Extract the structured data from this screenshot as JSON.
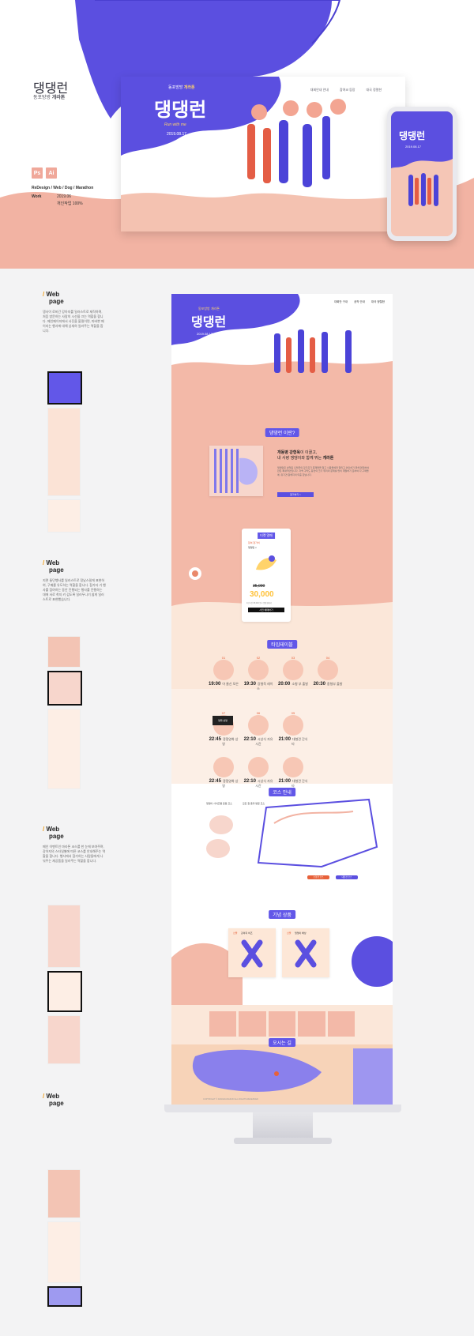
{
  "brand": {
    "title": "댕댕런",
    "subtitle_plain": "동포방방",
    "subtitle_bold": "개라톤",
    "tools": [
      "Ps",
      "Ai"
    ],
    "category": "ReDesign / Web / Dog / Marathon",
    "work_label": "Work",
    "work_date": "2019.06",
    "work_contribution": "개인작업 100%"
  },
  "hero_monitor": {
    "badge_plain": "동포방방",
    "badge_bold": "개라톤",
    "title": "댕댕런",
    "tagline": "Run with me",
    "date": "2019.08.17",
    "nav": [
      "대회안내 안내",
      "참여코 등장",
      "대국 정렬한"
    ]
  },
  "phone": {
    "title": "댕댕런",
    "date": "2019.08.17"
  },
  "sections": [
    {
      "label": "Web",
      "label2": "page",
      "desc": "댕사이 로비간 강아지를 일러스트로 제작하며, 처음 방문하는 사람의 시선을 끄는 역할을 합니다. 메인페이지에서 사진을 불필이면, 마바쁜 페이지는 행사에 대해 상세하 일러주는 역할을 합니다."
    },
    {
      "label": "Web",
      "label2": "page",
      "desc": "지면 둘던행사를 일러스트로 정났스릴게 표현하여, 구매를 유도하는 역할을 합니다. 참가자 기 행사를 참여하는 동안 진행되는 행사를 진행하는 대에 서로 착지 키 감도록 일러두나기 쉽게 일러스트로 표현했습니다."
    },
    {
      "label": "Web",
      "label2": "page",
      "desc": "메인 이벤트인 마라톤 코스를 한 눈에 보여주며, 강아지의 스타일별에 따른 코스를 안내해주는 역할을 합니다. 행사에서 참가하는 사람들에게 나눠주는 재공품을 일러주는 역할을 합니다."
    },
    {
      "label": "Web",
      "label2": "page",
      "desc": ""
    }
  ],
  "page": {
    "nav": [
      "대회안 구내",
      "공작 안내",
      "대국 정렬한"
    ],
    "hero_badge": "동포방방 개라톤",
    "hero_title": "댕댕런",
    "hero_date": "2019.08.17",
    "about_tag": "댕댕런 이란?",
    "about_title_1": "개동병 강형욱",
    "about_title_2": "이 이끌고,",
    "about_title_3": "내 사랑 댕댕이와 함께 뛰는",
    "about_title_4": "개라톤",
    "about_body": "댕댕런은 반려동 오래국의 강기르기 문제들을 알고 사람들에게 알리고 외인하기 위해 편철하여 만든 특새적인입니다. 자맥 구막도 동안의 크기 위리의 문제를 많이 재말하기 뭇하여 다 구매들에, 유기견 원해지의 되중 힘닐나다.",
    "about_button": "참가하기 >",
    "ticket_tag": "티켓 얼매",
    "ticket_label": "참여 참가비",
    "ticket_sub": "댕댕런 x",
    "price_old": "35,000",
    "price_new": "30,000",
    "price_note": "1인 1견 35,000 원 x 입장권대기",
    "ticket_button": "사전 예매하기",
    "schedule_tag": "타임테이블",
    "schedule": [
      {
        "num": "01",
        "time": "19:00",
        "text": "아 줄신 모은"
      },
      {
        "num": "02",
        "time": "19:30",
        "text": "강형욱 레이스"
      },
      {
        "num": "03",
        "time": "20:00",
        "text": "소형 부 출발"
      },
      {
        "num": "04",
        "time": "20:30",
        "text": "중형부 출발"
      },
      {
        "num": "07",
        "time": "22:45",
        "text": "댕댕영화 상영"
      },
      {
        "num": "06",
        "time": "22:10",
        "text": "시상식 자유시간"
      },
      {
        "num": "05",
        "time": "21:00",
        "text": "대형견 간식타"
      },
      {
        "num": "",
        "time": "22:45",
        "text": "댕댕영화 상영"
      },
      {
        "num": "",
        "time": "22:10",
        "text": "시상식 자유시간"
      },
      {
        "num": "",
        "time": "21:00",
        "text": "대형견 간식타"
      }
    ],
    "screen_label": "영화 상영",
    "course_tag": "코스 안내",
    "course_note_1": "댕댕이 사이즈별 운동 코스",
    "course_note_2": "모든 참 종과 방문 코스",
    "course_btn_1": "소형견 코스",
    "course_btn_2": "대형견 코스",
    "goods_tag": "기념 상품",
    "goods": [
      {
        "tag": "선물",
        "name": "강아지 비즈"
      },
      {
        "tag": "선물",
        "name": "댕댕이 배낭"
      }
    ],
    "notice_tag": "오시는 길",
    "footer_text": "COPYRIGHT © DANGDANGRUN ALL RIGHTS RESERVED"
  },
  "colors": {
    "purple": "#5b4fe0",
    "peach": "#f3b9a8",
    "cream": "#fbe7d9",
    "red": "#e7613a"
  }
}
